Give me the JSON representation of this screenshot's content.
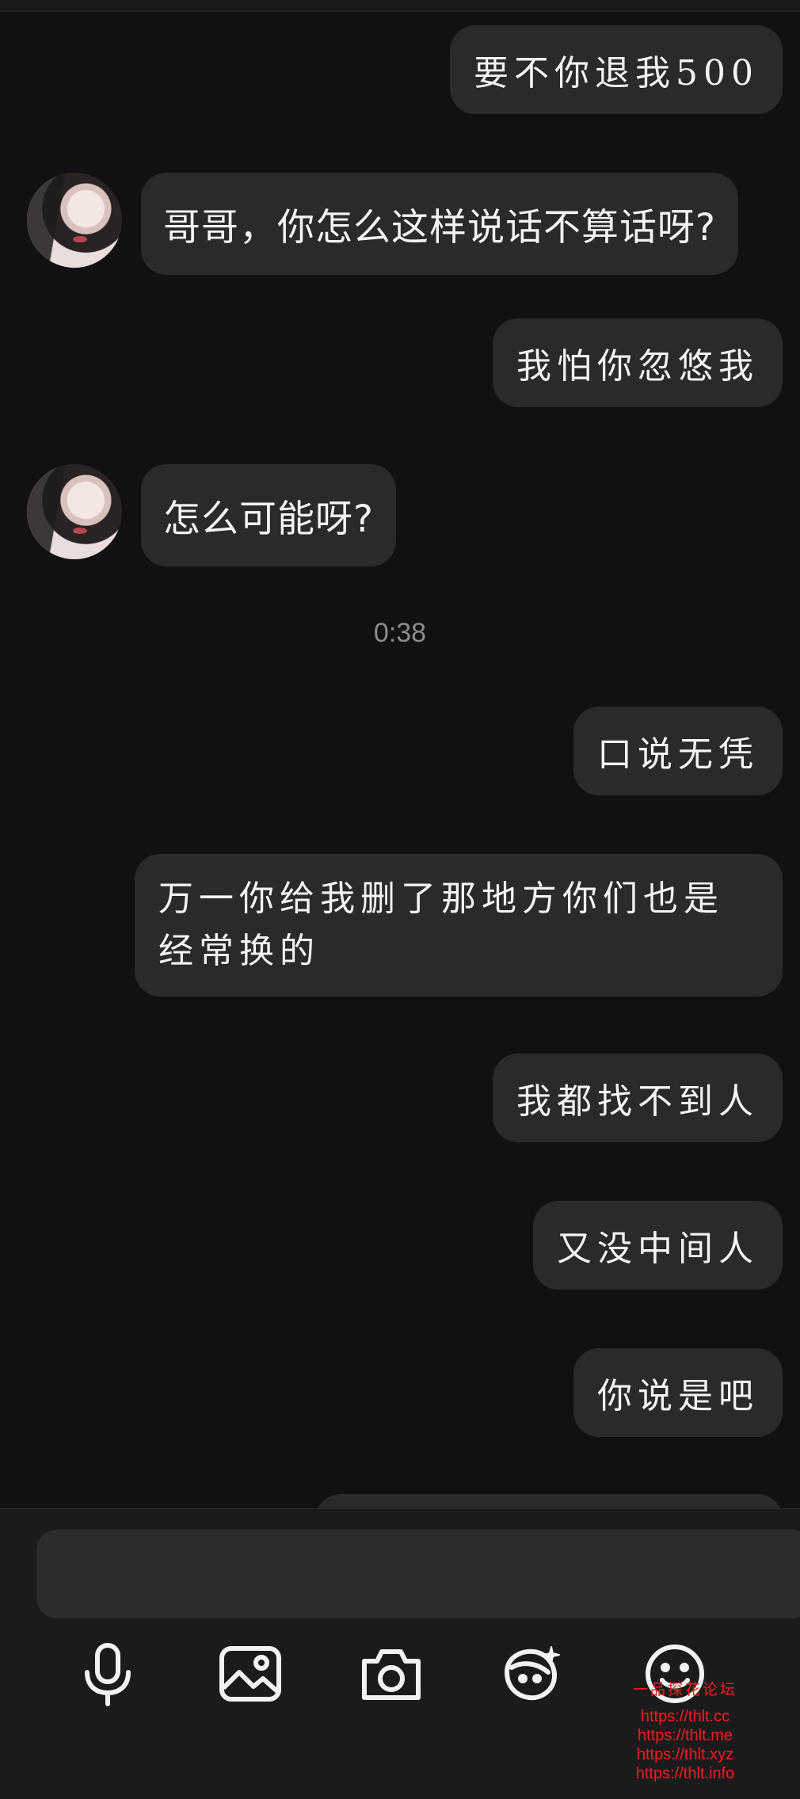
{
  "timestamp": "0:38",
  "messages": [
    {
      "text": "要不你退我500"
    },
    {
      "text": "哥哥，你怎么这样说话不算话呀?"
    },
    {
      "text": "我怕你忽悠我"
    },
    {
      "text": "怎么可能呀?"
    },
    {
      "text": "口说无凭"
    },
    {
      "text": "万一你给我删了那地方你们也是经常换的"
    },
    {
      "text": "我都找不到人"
    },
    {
      "text": "又没中间人"
    },
    {
      "text": "你说是吧"
    }
  ],
  "input": {
    "value": ""
  },
  "toolbar": {
    "icons": [
      "microphone-icon",
      "image-icon",
      "camera-icon",
      "ai-sticker-icon",
      "emoji-icon"
    ]
  },
  "watermark": {
    "title": "一品探花论坛",
    "lines": [
      "https://thlt.cc",
      "https://thlt.me",
      "https://thlt.xyz",
      "https://thlt.info"
    ]
  },
  "colors": {
    "background": "#111113",
    "bubble": "#2a2a2d",
    "text": "#f3f3f3",
    "timestamp": "#8b8b90",
    "watermark": "#ff1a1a"
  }
}
